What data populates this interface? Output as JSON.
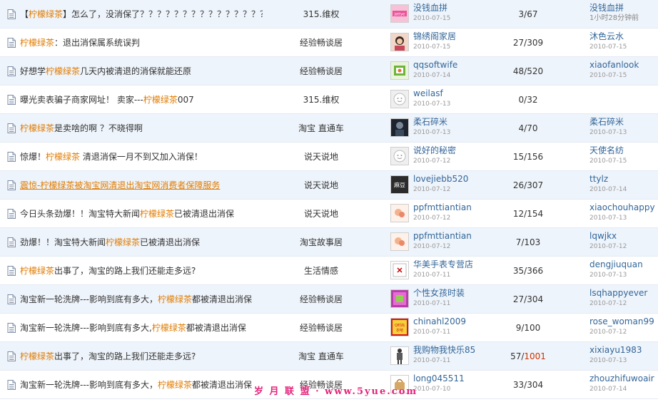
{
  "theme": {
    "keyword_color": "#e07b00",
    "link_color": "#336699",
    "date_color": "#999999",
    "row_alt_bg": "#eef4fb",
    "hot_count_color": "#cc3300",
    "watermark_color": "#e5237a"
  },
  "rows": [
    {
      "title": [
        {
          "t": "【",
          "kw": false
        },
        {
          "t": "柠檬绿茶",
          "kw": true
        },
        {
          "t": "】怎么了，没消保了？？？？？？？？？？？？？？？？",
          "kw": false
        }
      ],
      "forum": "315.维权",
      "avatar": "pink",
      "avatar_text": "Jettye",
      "author": "没钱血拼",
      "post_date": "2010-07-15",
      "replies": "3",
      "views": "67",
      "views_hot": false,
      "last_user": "没钱血拼",
      "last_time": "1小时28分钟前",
      "fresh": true
    },
    {
      "title": [
        {
          "t": "柠檬绿茶",
          "kw": true
        },
        {
          "t": "：退出消保属系统误判",
          "kw": false
        }
      ],
      "forum": "经验畅谈居",
      "avatar": "lady",
      "avatar_text": "",
      "author": "锦绣阁家居",
      "post_date": "2010-07-15",
      "replies": "27",
      "views": "309",
      "views_hot": false,
      "last_user": "沐色云水",
      "last_time": "2010-07-15",
      "fresh": false
    },
    {
      "title": [
        {
          "t": "好想学",
          "kw": false
        },
        {
          "t": "柠檬绿茶",
          "kw": true
        },
        {
          "t": "几天内被清退的消保就能还原",
          "kw": false
        }
      ],
      "forum": "经验畅谈居",
      "avatar": "green",
      "avatar_text": "",
      "author": "qqsoftwife",
      "post_date": "2010-07-14",
      "replies": "48",
      "views": "520",
      "views_hot": false,
      "last_user": "xiaofanlook",
      "last_time": "2010-07-15",
      "fresh": false
    },
    {
      "title": [
        {
          "t": "曝光卖表骗子商家网址！ 卖家---",
          "kw": false
        },
        {
          "t": "柠檬绿茶",
          "kw": true
        },
        {
          "t": "007",
          "kw": false
        }
      ],
      "forum": "315.维权",
      "avatar": "default",
      "avatar_text": "",
      "author": "weilasf",
      "post_date": "2010-07-13",
      "replies": "0",
      "views": "32",
      "views_hot": false,
      "last_user": "",
      "last_time": "",
      "fresh": false
    },
    {
      "title": [
        {
          "t": "柠檬绿茶",
          "kw": true
        },
        {
          "t": "是卖啥的啊 ？不晓得啊",
          "kw": false
        }
      ],
      "forum": "淘宝 直通车",
      "avatar": "dark",
      "avatar_text": "",
      "author": "柔石碎米",
      "post_date": "2010-07-13",
      "replies": "4",
      "views": "70",
      "views_hot": false,
      "last_user": "柔石碎米",
      "last_time": "2010-07-13",
      "fresh": false
    },
    {
      "title": [
        {
          "t": "惊爆！",
          "kw": false
        },
        {
          "t": "柠檬绿茶",
          "kw": true
        },
        {
          "t": " 清退消保一月不到又加入消保！",
          "kw": false
        }
      ],
      "forum": "说天说地",
      "avatar": "default",
      "avatar_text": "",
      "author": "说好的秘密",
      "post_date": "2010-07-12",
      "replies": "15",
      "views": "156",
      "views_hot": false,
      "last_user": "天使名纺",
      "last_time": "2010-07-15",
      "fresh": false
    },
    {
      "title": [
        {
          "t": "震惊-",
          "kw": false
        },
        {
          "t": "柠檬绿茶",
          "kw": true
        },
        {
          "t": "被淘宝网清退出淘宝网消费者保障服务",
          "kw": false
        }
      ],
      "link": true,
      "forum": "说天说地",
      "avatar": "black",
      "avatar_text": "麻豆",
      "author": "lovejiebb520",
      "post_date": "2010-07-12",
      "replies": "26",
      "views": "307",
      "views_hot": false,
      "last_user": "ttylz",
      "last_time": "2010-07-14",
      "fresh": false
    },
    {
      "title": [
        {
          "t": "今日头条劲爆！！淘宝特大新闻",
          "kw": false
        },
        {
          "t": "柠檬绿茶",
          "kw": true
        },
        {
          "t": "已被清退出消保",
          "kw": false
        }
      ],
      "forum": "说天说地",
      "avatar": "orange",
      "avatar_text": "",
      "author": "ppfmttiantian",
      "post_date": "2010-07-12",
      "replies": "12",
      "views": "154",
      "views_hot": false,
      "last_user": "xiaochouhappy",
      "last_time": "2010-07-13",
      "fresh": false
    },
    {
      "title": [
        {
          "t": "劲爆！！淘宝特大新闻",
          "kw": false
        },
        {
          "t": "柠檬绿茶",
          "kw": true
        },
        {
          "t": "已被清退出消保",
          "kw": false
        }
      ],
      "forum": "淘宝故事居",
      "avatar": "orange",
      "avatar_text": "",
      "author": "ppfmttiantian",
      "post_date": "2010-07-12",
      "replies": "7",
      "views": "103",
      "views_hot": false,
      "last_user": "lqwjkx",
      "last_time": "2010-07-12",
      "fresh": false
    },
    {
      "title": [
        {
          "t": "柠檬绿茶",
          "kw": true
        },
        {
          "t": "出事了，淘宝的路上我们还能走多远?",
          "kw": false
        }
      ],
      "forum": "生活情感",
      "avatar": "broken",
      "avatar_text": "",
      "author": "华美手表专营店",
      "post_date": "2010-07-11",
      "replies": "35",
      "views": "366",
      "views_hot": false,
      "last_user": "dengjiuquan",
      "last_time": "2010-07-13",
      "fresh": false
    },
    {
      "title": [
        {
          "t": "淘宝新一轮洗牌---影响到底有多大，",
          "kw": false
        },
        {
          "t": "柠檬绿茶",
          "kw": true
        },
        {
          "t": "都被清退出消保",
          "kw": false
        }
      ],
      "forum": "经验畅谈居",
      "avatar": "purple",
      "avatar_text": "",
      "author": "个性女孩时装",
      "post_date": "2010-07-11",
      "replies": "27",
      "views": "304",
      "views_hot": false,
      "last_user": "lsqhappyever",
      "last_time": "2010-07-12",
      "fresh": false
    },
    {
      "title": [
        {
          "t": "淘宝新一轮洗牌---影响到底有多大,",
          "kw": false
        },
        {
          "t": "柠檬绿茶",
          "kw": true
        },
        {
          "t": "都被清退出消保",
          "kw": false
        }
      ],
      "forum": "经验畅谈居",
      "avatar": "redbox",
      "avatar_text": "Q时尚衣吧",
      "author": "chinahl2009",
      "post_date": "2010-07-11",
      "replies": "9",
      "views": "100",
      "views_hot": false,
      "last_user": "rose_woman99",
      "last_time": "2010-07-12",
      "fresh": false
    },
    {
      "title": [
        {
          "t": "柠檬绿茶",
          "kw": true
        },
        {
          "t": "出事了，淘宝的路上我们还能走多远?",
          "kw": false
        }
      ],
      "forum": "淘宝 直通车",
      "avatar": "figure",
      "avatar_text": "",
      "author": "我购物我快乐85",
      "post_date": "2010-07-11",
      "replies": "57",
      "views": "1001",
      "views_hot": true,
      "last_user": "xixiayu1983",
      "last_time": "2010-07-13",
      "fresh": false
    },
    {
      "title": [
        {
          "t": "淘宝新一轮洗牌---影响到底有多大，",
          "kw": false
        },
        {
          "t": "柠檬绿茶",
          "kw": true
        },
        {
          "t": "都被清退出消保",
          "kw": false
        }
      ],
      "forum": "经验畅谈居",
      "avatar": "bag",
      "avatar_text": "",
      "author": "long045511",
      "post_date": "2010-07-10",
      "replies": "33",
      "views": "304",
      "views_hot": false,
      "last_user": "zhouzhifuwoair",
      "last_time": "2010-07-14",
      "fresh": false
    }
  ],
  "watermark": "岁 月 联 盟 · www.5yue.com"
}
